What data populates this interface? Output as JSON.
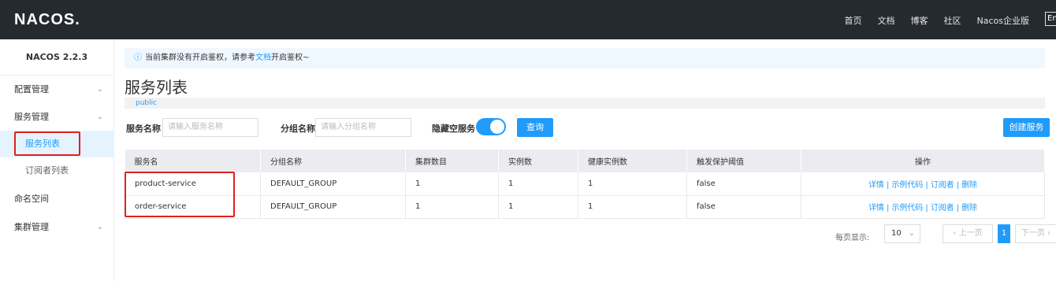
{
  "header": {
    "logo": "NACOS.",
    "nav": [
      "首页",
      "文档",
      "博客",
      "社区",
      "Nacos企业版"
    ],
    "lang": "En"
  },
  "sidebar": {
    "version": "NACOS 2.2.3",
    "items": [
      {
        "label": "配置管理"
      },
      {
        "label": "服务管理"
      },
      {
        "label": "服务列表"
      },
      {
        "label": "订阅者列表"
      },
      {
        "label": "命名空间"
      },
      {
        "label": "集群管理"
      }
    ]
  },
  "notice": {
    "icon": "info-icon",
    "text_before": "当前集群没有开启鉴权，请参考",
    "link": "文档",
    "text_after": "开启鉴权~"
  },
  "page": {
    "title": "服务列表",
    "namespace": "public"
  },
  "filters": {
    "service_label": "服务名称",
    "service_placeholder": "请输入服务名称",
    "group_label": "分组名称",
    "group_placeholder": "请输入分组名称",
    "hide_empty_label": "隐藏空服务",
    "hide_empty_on": true,
    "query_button": "查询",
    "create_button": "创建服务"
  },
  "table": {
    "columns": [
      "服务名",
      "分组名称",
      "集群数目",
      "实例数",
      "健康实例数",
      "触发保护阈值",
      "操作"
    ],
    "rows": [
      {
        "name": "product-service",
        "group": "DEFAULT_GROUP",
        "clusters": "1",
        "instances": "1",
        "healthy": "1",
        "threshold": "false"
      },
      {
        "name": "order-service",
        "group": "DEFAULT_GROUP",
        "clusters": "1",
        "instances": "1",
        "healthy": "1",
        "threshold": "false"
      }
    ],
    "ops": [
      "详情",
      "示例代码",
      "订阅者",
      "删除"
    ],
    "sep": "|"
  },
  "pager": {
    "page_size_label": "每页显示:",
    "page_size": "10",
    "prev": "上一页",
    "current": "1",
    "next": "下一页"
  },
  "colors": {
    "accent": "#209bfa",
    "topbar": "#252a2f",
    "highlight_box": "#e02020"
  }
}
